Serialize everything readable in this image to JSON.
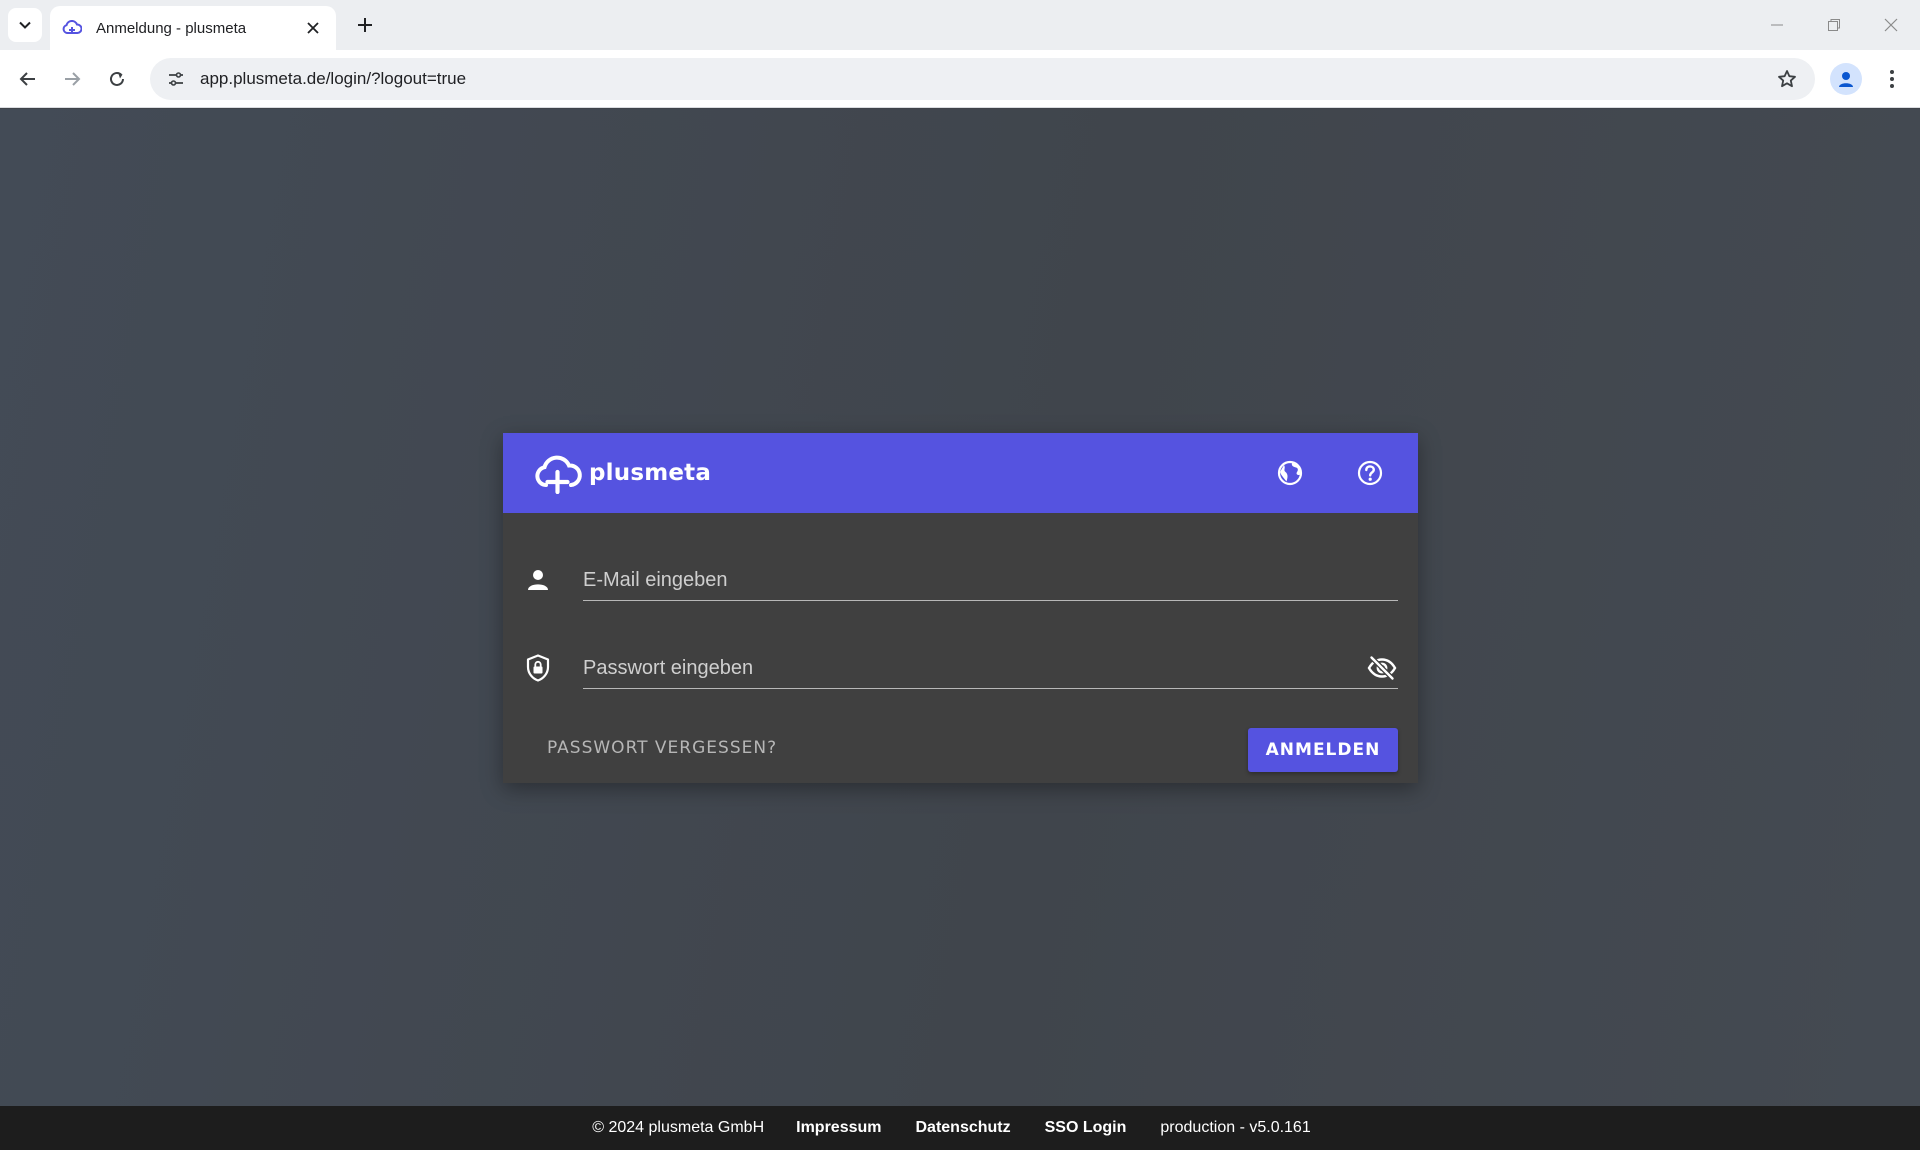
{
  "browser": {
    "tab_title": "Anmeldung - plusmeta",
    "url": "app.plusmeta.de/login/?logout=true"
  },
  "app": {
    "logo_text": "plusmeta",
    "colors": {
      "primary": "#5553e0",
      "card": "#404040",
      "footer": "#1d1d1d"
    }
  },
  "login": {
    "email_placeholder": "E-Mail eingeben",
    "password_placeholder": "Passwort eingeben",
    "forgot_label": "PASSWORT VERGESSEN?",
    "submit_label": "ANMELDEN"
  },
  "footer": {
    "copyright": "© 2024 plusmeta GmbH",
    "links": [
      "Impressum",
      "Datenschutz",
      "SSO Login"
    ],
    "version": "production - v5.0.161"
  },
  "icons": {
    "header": [
      "globe-icon",
      "help-icon"
    ],
    "fields": [
      "user-icon",
      "shield-lock-icon",
      "eye-off-icon"
    ]
  }
}
